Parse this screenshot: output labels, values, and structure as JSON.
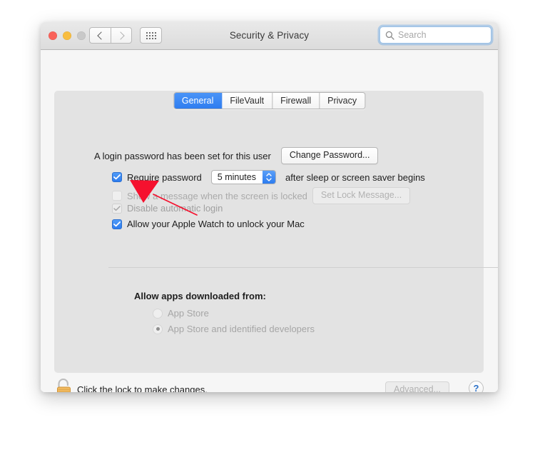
{
  "window": {
    "title": "Security & Privacy",
    "traffic_lights": [
      "close",
      "minimize",
      "zoom"
    ],
    "nav": {
      "back_icon": "chevron-left-icon",
      "forward_icon": "chevron-right-icon",
      "showall_icon": "grid-icon"
    },
    "search": {
      "placeholder": "Search",
      "value": "",
      "icon": "search-icon"
    }
  },
  "tabs": [
    {
      "label": "General",
      "active": true
    },
    {
      "label": "FileVault",
      "active": false
    },
    {
      "label": "Firewall",
      "active": false
    },
    {
      "label": "Privacy",
      "active": false
    }
  ],
  "general": {
    "password_status": "A login password has been set for this user",
    "change_password_button": "Change Password...",
    "require_password": {
      "label": "Require password",
      "checked": true,
      "enabled": true,
      "delay_value": "5 minutes",
      "suffix": "after sleep or screen saver begins"
    },
    "show_message": {
      "label": "Show a message when the screen is locked",
      "checked": false,
      "enabled": false,
      "button": "Set Lock Message..."
    },
    "disable_auto_login": {
      "label": "Disable automatic login",
      "checked": true,
      "enabled": false
    },
    "apple_watch": {
      "label": "Allow your Apple Watch to unlock your Mac",
      "checked": true,
      "enabled": true
    },
    "allow_apps": {
      "title": "Allow apps downloaded from:",
      "options": [
        {
          "label": "App Store",
          "selected": false,
          "enabled": false
        },
        {
          "label": "App Store and identified developers",
          "selected": true,
          "enabled": false
        }
      ]
    }
  },
  "bottom": {
    "lock_icon": "unlocked-padlock-icon",
    "lock_message": "Click the lock to make changes.",
    "advanced_button": "Advanced...",
    "help_button": "?"
  },
  "annotation": {
    "type": "red-arrow",
    "color": "#f5112e",
    "points_at": "Allow your Apple Watch to unlock your Mac"
  },
  "colors": {
    "accent_blue": "#2f7df0",
    "annotation_red": "#f5112e",
    "panel_gray": "#e3e3e3",
    "window_gray": "#f6f6f6",
    "lock_gold": "#f0b860"
  }
}
